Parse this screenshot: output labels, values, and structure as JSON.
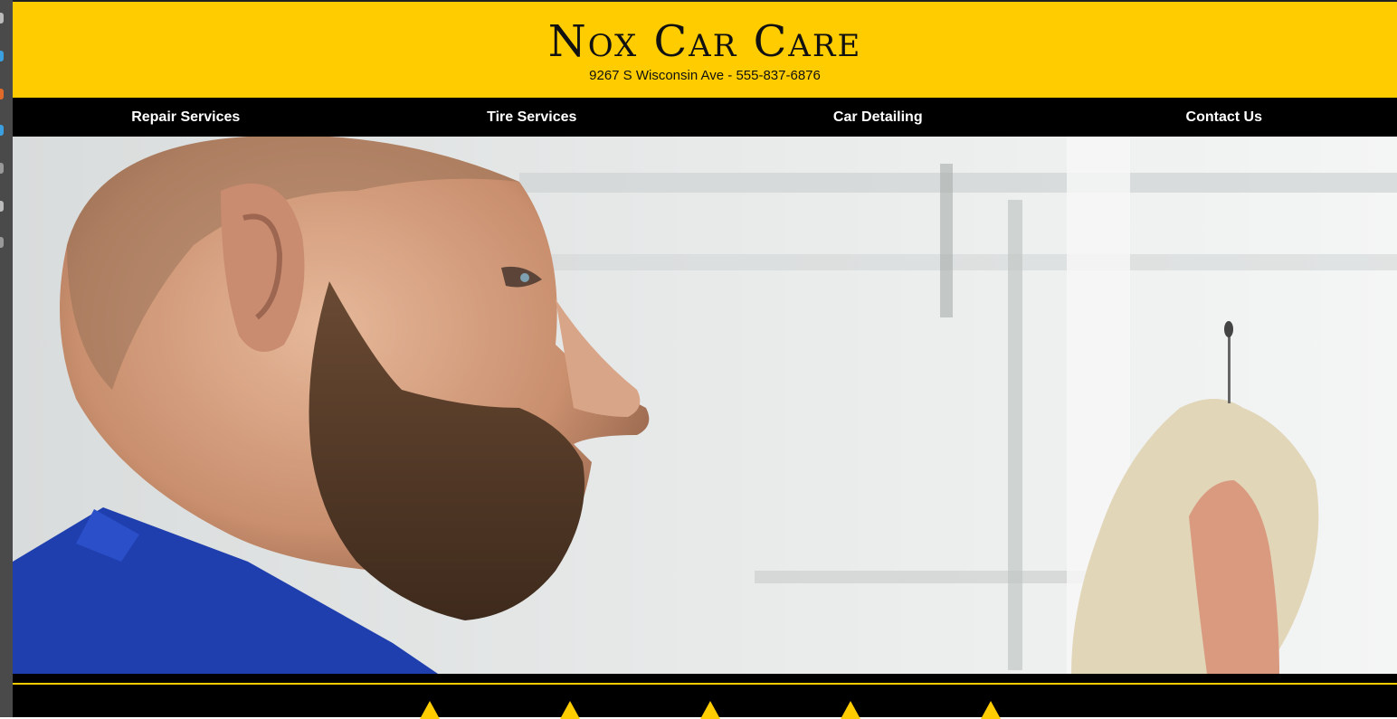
{
  "header": {
    "title": "Nox Car Care",
    "address": "9267 S Wisconsin Ave - 555-837-6876"
  },
  "nav": {
    "items": [
      {
        "label": "Repair Services"
      },
      {
        "label": "Tire Services"
      },
      {
        "label": "Car Detailing"
      },
      {
        "label": "Contact Us"
      }
    ]
  },
  "hero": {
    "image_subject": "mechanic checking engine oil dipstick"
  },
  "colors": {
    "brand_yellow": "#ffcc00",
    "nav_black": "#000000",
    "text_dark": "#111111",
    "nav_text": "#ffffff"
  }
}
